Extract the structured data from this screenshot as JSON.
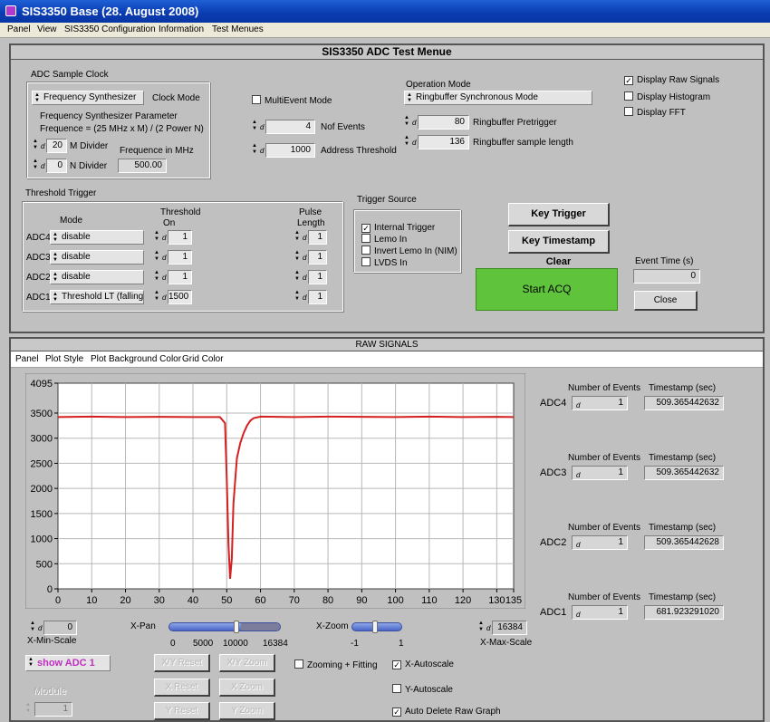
{
  "window": {
    "title": "SIS3350 Base (28. August 2008)"
  },
  "menubar": [
    "Panel",
    "View",
    "SIS3350 Configuration",
    "Information",
    "Test Menues"
  ],
  "adc_panel": {
    "title": "SIS3350 ADC Test Menue",
    "sample_clock": {
      "group_label": "ADC Sample Clock",
      "clock_mode_value": "Frequency Synthesizer",
      "clock_mode_label": "Clock Mode",
      "param_line1": "Frequency Synthesizer Parameter",
      "param_line2": "Frequence = (25 MHz x M) / (2 Power N)",
      "m_divider_value": "20",
      "m_divider_label": "M Divider",
      "n_divider_value": "0",
      "n_divider_label": "N Divider",
      "freq_label": "Frequence in MHz",
      "freq_value": "500.00"
    },
    "multievent": {
      "checkbox_label": "MultiEvent Mode",
      "checked": false,
      "nof_events_value": "4",
      "nof_events_label": "Nof Events",
      "address_threshold_value": "1000",
      "address_threshold_label": "Address Threshold"
    },
    "operation": {
      "label": "Operation Mode",
      "value": "Ringbuffer Synchronous Mode",
      "pretrigger_value": "80",
      "pretrigger_label": "Ringbuffer Pretrigger",
      "sample_length_value": "136",
      "sample_length_label": "Ringbuffer sample length"
    },
    "display": {
      "raw_signals": "Display Raw Signals",
      "raw_signals_checked": true,
      "histogram": "Display Histogram",
      "histogram_checked": false,
      "fft": "Display FFT",
      "fft_checked": false
    },
    "threshold_trigger": {
      "group_label": "Threshold Trigger",
      "col_mode": "Mode",
      "col_threshold_1": "Threshold",
      "col_threshold_2": "On",
      "col_pulse_1": "Pulse",
      "col_pulse_2": "Length",
      "rows": [
        {
          "adc": "ADC4",
          "mode": "disable",
          "threshold": "1",
          "pulse": "1"
        },
        {
          "adc": "ADC3",
          "mode": "disable",
          "threshold": "1",
          "pulse": "1"
        },
        {
          "adc": "ADC2",
          "mode": "disable",
          "threshold": "1",
          "pulse": "1"
        },
        {
          "adc": "ADC1",
          "mode": "Threshold LT (falling)",
          "threshold": "1500",
          "pulse": "1"
        }
      ]
    },
    "trigger_source": {
      "group_label": "Trigger Source",
      "internal": "Internal Trigger",
      "internal_checked": true,
      "lemo_in": "Lemo In",
      "lemo_in_checked": false,
      "invert_lemo": "Invert Lemo In (NIM)",
      "invert_lemo_checked": false,
      "lvds_in": "LVDS In",
      "lvds_in_checked": false
    },
    "key_trigger": "Key Trigger",
    "key_timestamp_clear": "Key Timestamp Clear",
    "start_acq": "Start ACQ",
    "event_time_label": "Event Time  (s)",
    "event_time_value": "0",
    "close": "Close"
  },
  "raw_panel": {
    "title": "RAW SIGNALS",
    "menu": [
      "Panel",
      "Plot Style",
      "Plot Background Color",
      "Grid Color"
    ],
    "channels": [
      {
        "adc": "ADC4",
        "events_label": "Number of Events",
        "events": "1",
        "timestamp_label": "Timestamp (sec)",
        "timestamp": "509.365442632"
      },
      {
        "adc": "ADC3",
        "events_label": "Number of Events",
        "events": "1",
        "timestamp_label": "Timestamp (sec)",
        "timestamp": "509.365442632"
      },
      {
        "adc": "ADC2",
        "events_label": "Number of Events",
        "events": "1",
        "timestamp_label": "Timestamp  (sec)",
        "timestamp": "509.365442628"
      },
      {
        "adc": "ADC1",
        "events_label": "Number of Events",
        "events": "1",
        "timestamp_label": "Timestamp  (sec)",
        "timestamp": "681.923291020"
      }
    ],
    "x_min_value": "0",
    "x_min_label": "X-Min-Scale",
    "x_max_value": "16384",
    "x_max_label": "X-Max-Scale",
    "x_pan_label": "X-Pan",
    "x_pan_ticks": [
      "0",
      "5000",
      "10000",
      "16384"
    ],
    "x_pan_position": 0.6,
    "x_zoom_label": "X-Zoom",
    "x_zoom_ticks": [
      "-1",
      "1"
    ],
    "x_zoom_position": 0.5,
    "show_adc": "show ADC 1",
    "xy_reset": "X/Y Reset",
    "xy_zoom": "X/Y Zoom",
    "x_reset": "X Reset",
    "x_zoom": "X Zoom",
    "y_reset": "Y Reset",
    "y_zoom": "Y Zoom",
    "zoom_fitting": "Zooming + Fitting",
    "zoom_fitting_checked": false,
    "x_autoscale": "X-Autoscale",
    "x_autoscale_checked": true,
    "y_autoscale": "Y-Autoscale",
    "y_autoscale_checked": false,
    "auto_delete": "Auto Delete Raw Graph",
    "auto_delete_checked": true,
    "module_label": "Module",
    "module_value": "1"
  },
  "chart_data": {
    "type": "line",
    "title": "",
    "xlabel": "",
    "ylabel": "",
    "xlim": [
      0,
      135
    ],
    "ylim": [
      0,
      4095
    ],
    "x_ticks": [
      0,
      10,
      20,
      30,
      40,
      50,
      60,
      70,
      80,
      90,
      100,
      110,
      120,
      130,
      135
    ],
    "y_ticks": [
      0,
      500,
      1000,
      1500,
      2000,
      2500,
      3000,
      3500,
      4095
    ],
    "grid": true,
    "line_color": "#d42020",
    "background": "#ffffff",
    "series": [
      {
        "x": [
          0,
          10,
          20,
          30,
          40,
          48,
          49.5,
          50,
          50.5,
          51,
          51.5,
          52,
          53,
          54,
          55,
          56,
          57,
          58,
          60,
          70,
          80,
          90,
          100,
          110,
          120,
          130,
          135
        ],
        "y": [
          3420,
          3430,
          3420,
          3425,
          3420,
          3420,
          3300,
          2200,
          900,
          200,
          600,
          1700,
          2600,
          2900,
          3100,
          3250,
          3350,
          3400,
          3430,
          3420,
          3430,
          3425,
          3420,
          3430,
          3420,
          3425,
          3420
        ]
      }
    ]
  }
}
